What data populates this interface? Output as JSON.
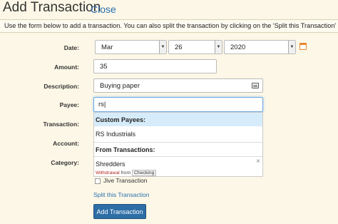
{
  "header": {
    "title": "Add Transaction",
    "close_label": "Close"
  },
  "intro_text": "Use the form below to add a transaction. You can also split the transaction by clicking on the 'Split this Transaction' link.",
  "form": {
    "date_label": "Date:",
    "date_month": "Mar",
    "date_day": "26",
    "date_year": "2020",
    "amount_label": "Amount:",
    "amount_value": "35",
    "description_label": "Description:",
    "description_value": "Buying paper",
    "payee_label": "Payee:",
    "payee_value": "rs|",
    "transaction_label": "Transaction:",
    "account_label": "Account:",
    "category_label": "Category:",
    "jive_label": "Jive Transaction",
    "split_link": "Split this Transaction",
    "submit_label": "Add Transaction"
  },
  "payee_dropdown": {
    "custom_header": "Custom Payees:",
    "custom_items": [
      "RS Industrials"
    ],
    "transactions_header": "From Transactions:",
    "transaction_item": {
      "name": "Shredders",
      "type": "Withdrawal",
      "from_word": "from",
      "account": "Checking",
      "remove_glyph": "×"
    }
  },
  "icons": {
    "calendar": "calendar-icon",
    "description": "card-icon"
  },
  "colors": {
    "background": "#fcf7e6",
    "link": "#2a6fb0",
    "button": "#2d6ea6",
    "highlight": "#d7ecfa",
    "withdrawal": "#b3261e"
  }
}
